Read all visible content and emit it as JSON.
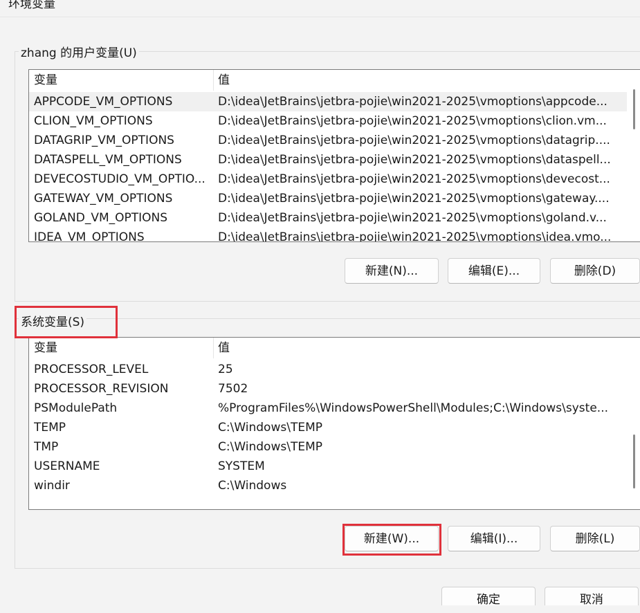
{
  "window": {
    "title": "环境变量"
  },
  "user_vars": {
    "group_label": "zhang 的用户变量(U)",
    "columns": [
      "变量",
      "值"
    ],
    "rows": [
      {
        "name": "APPCODE_VM_OPTIONS",
        "value": "D:\\idea\\JetBrains\\jetbra-pojie\\win2021-2025\\vmoptions\\appcode..."
      },
      {
        "name": "CLION_VM_OPTIONS",
        "value": "D:\\idea\\JetBrains\\jetbra-pojie\\win2021-2025\\vmoptions\\clion.vm..."
      },
      {
        "name": "DATAGRIP_VM_OPTIONS",
        "value": "D:\\idea\\JetBrains\\jetbra-pojie\\win2021-2025\\vmoptions\\datagrip...."
      },
      {
        "name": "DATASPELL_VM_OPTIONS",
        "value": "D:\\idea\\JetBrains\\jetbra-pojie\\win2021-2025\\vmoptions\\dataspell..."
      },
      {
        "name": "DEVECOSTUDIO_VM_OPTIO...",
        "value": "D:\\idea\\JetBrains\\jetbra-pojie\\win2021-2025\\vmoptions\\devecost..."
      },
      {
        "name": "GATEWAY_VM_OPTIONS",
        "value": "D:\\idea\\JetBrains\\jetbra-pojie\\win2021-2025\\vmoptions\\gateway...."
      },
      {
        "name": "GOLAND_VM_OPTIONS",
        "value": "D:\\idea\\JetBrains\\jetbra-pojie\\win2021-2025\\vmoptions\\goland.v..."
      },
      {
        "name": "IDEA_VM_OPTIONS",
        "value": "D:\\idea\\JetBrains\\jetbra-pojie\\win2021-2025\\vmoptions\\idea.vmo..."
      }
    ],
    "buttons": {
      "new": "新建(N)...",
      "edit": "编辑(E)...",
      "delete": "删除(D)"
    }
  },
  "system_vars": {
    "group_label": "系统变量(S)",
    "columns": [
      "变量",
      "值"
    ],
    "rows": [
      {
        "name": "PROCESSOR_LEVEL",
        "value": "25"
      },
      {
        "name": "PROCESSOR_REVISION",
        "value": "7502"
      },
      {
        "name": "PSModulePath",
        "value": "%ProgramFiles%\\WindowsPowerShell\\Modules;C:\\Windows\\syste..."
      },
      {
        "name": "TEMP",
        "value": "C:\\Windows\\TEMP"
      },
      {
        "name": "TMP",
        "value": "C:\\Windows\\TEMP"
      },
      {
        "name": "USERNAME",
        "value": "SYSTEM"
      },
      {
        "name": "windir",
        "value": "C:\\Windows"
      }
    ],
    "buttons": {
      "new": "新建(W)...",
      "edit": "编辑(I)...",
      "delete": "删除(L)"
    }
  },
  "dialog_buttons": {
    "ok": "确定",
    "cancel": "取消"
  },
  "colors": {
    "highlight": "#e0313b",
    "selected_row": "#f0f0f0"
  }
}
